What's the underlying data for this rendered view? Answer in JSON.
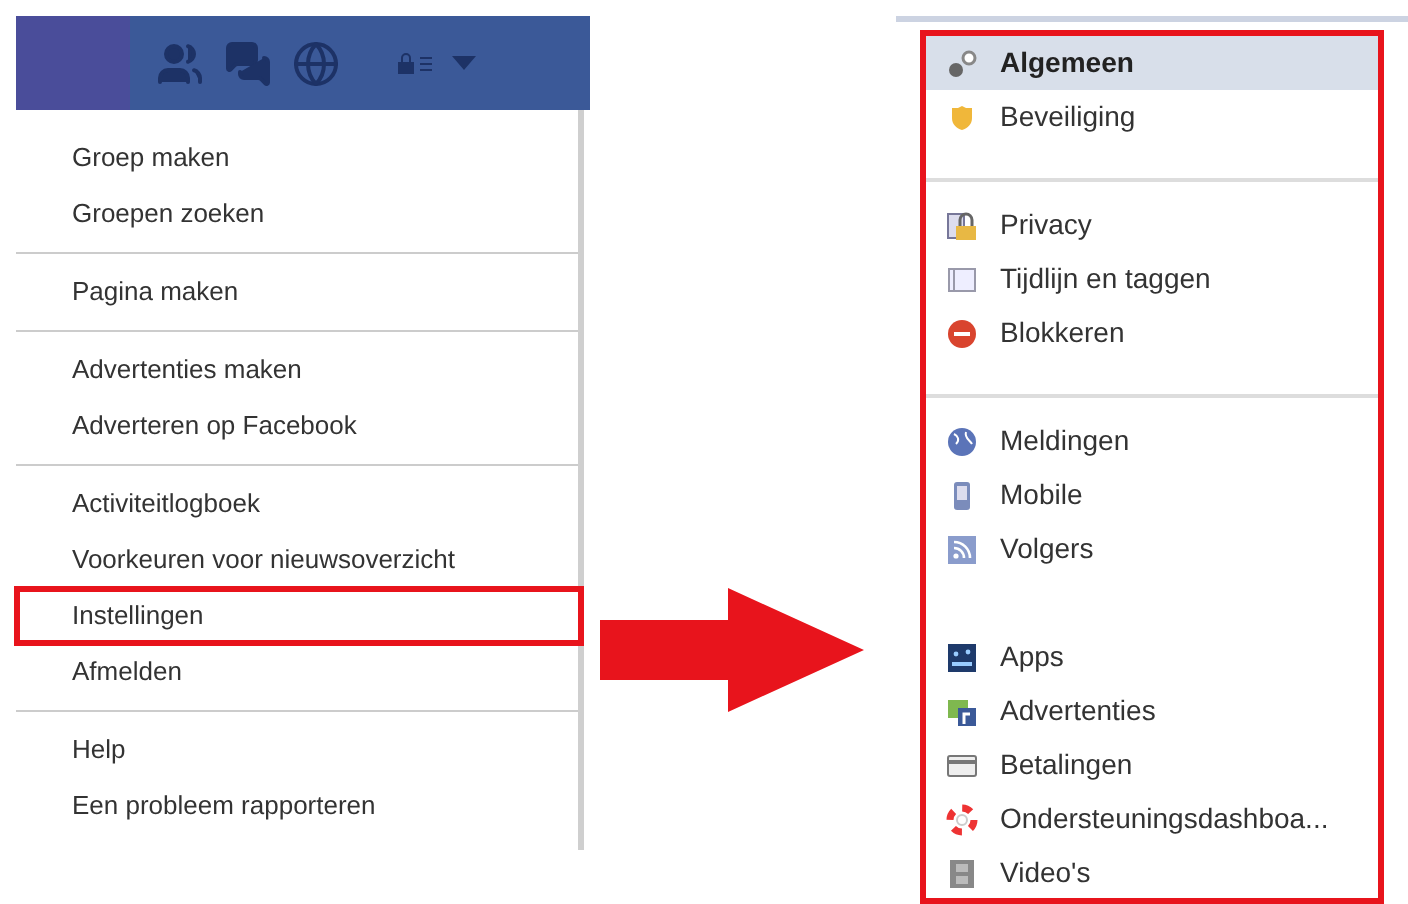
{
  "account_menu": {
    "groups": [
      {
        "items": [
          {
            "label": "Groep maken",
            "highlighted": false
          },
          {
            "label": "Groepen zoeken",
            "highlighted": false
          }
        ]
      },
      {
        "items": [
          {
            "label": "Pagina maken",
            "highlighted": false
          }
        ]
      },
      {
        "items": [
          {
            "label": "Advertenties maken",
            "highlighted": false
          },
          {
            "label": "Adverteren op Facebook",
            "highlighted": false
          }
        ]
      },
      {
        "items": [
          {
            "label": "Activiteitlogboek",
            "highlighted": false
          },
          {
            "label": "Voorkeuren voor nieuwsoverzicht",
            "highlighted": false
          },
          {
            "label": "Instellingen",
            "highlighted": true
          },
          {
            "label": "Afmelden",
            "highlighted": false
          }
        ]
      },
      {
        "items": [
          {
            "label": "Help",
            "highlighted": false
          },
          {
            "label": "Een probleem rapporteren",
            "highlighted": false
          }
        ]
      }
    ]
  },
  "settings_sidebar": {
    "groups": [
      {
        "divider": false,
        "items": [
          {
            "label": "Algemeen",
            "selected": true
          },
          {
            "label": "Beveiliging",
            "selected": false
          }
        ]
      },
      {
        "divider": true,
        "items": [
          {
            "label": "Privacy",
            "selected": false
          },
          {
            "label": "Tijdlijn en taggen",
            "selected": false
          },
          {
            "label": "Blokkeren",
            "selected": false
          }
        ]
      },
      {
        "divider": true,
        "items": [
          {
            "label": "Meldingen",
            "selected": false
          },
          {
            "label": "Mobile",
            "selected": false
          },
          {
            "label": "Volgers",
            "selected": false
          }
        ]
      },
      {
        "divider": false,
        "items": [
          {
            "label": "Apps",
            "selected": false
          },
          {
            "label": "Advertenties",
            "selected": false
          },
          {
            "label": "Betalingen",
            "selected": false
          },
          {
            "label": "Ondersteuningsdashboa...",
            "selected": false
          },
          {
            "label": "Video's",
            "selected": false
          }
        ]
      }
    ]
  }
}
